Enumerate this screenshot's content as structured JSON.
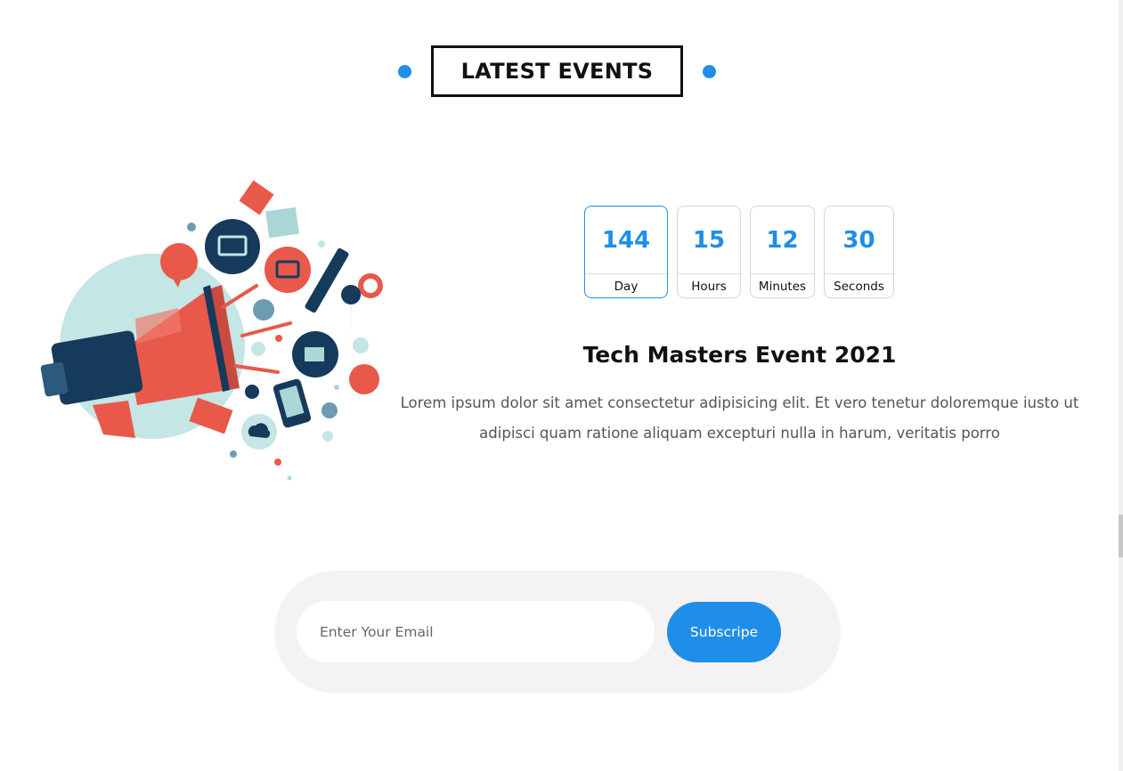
{
  "section": {
    "title": "LATEST EVENTS"
  },
  "illustration": {
    "icon": "megaphone-marketing-icon"
  },
  "countdown": [
    {
      "value": "144",
      "label": "Day"
    },
    {
      "value": "15",
      "label": "Hours"
    },
    {
      "value": "12",
      "label": "Minutes"
    },
    {
      "value": "30",
      "label": "Seconds"
    }
  ],
  "event": {
    "title": "Tech Masters Event 2021",
    "description": "Lorem ipsum dolor sit amet consectetur adipisicing elit. Et vero tenetur doloremque iusto ut adipisci quam ratione aliquam excepturi nulla in harum, veritatis porro"
  },
  "subscribe": {
    "placeholder": "Enter Your Email",
    "button_label": "Subscripe"
  },
  "colors": {
    "accent": "#1f8ee8",
    "coral": "#e8594a",
    "navy": "#163a5c",
    "mint": "#c4e6e4"
  }
}
